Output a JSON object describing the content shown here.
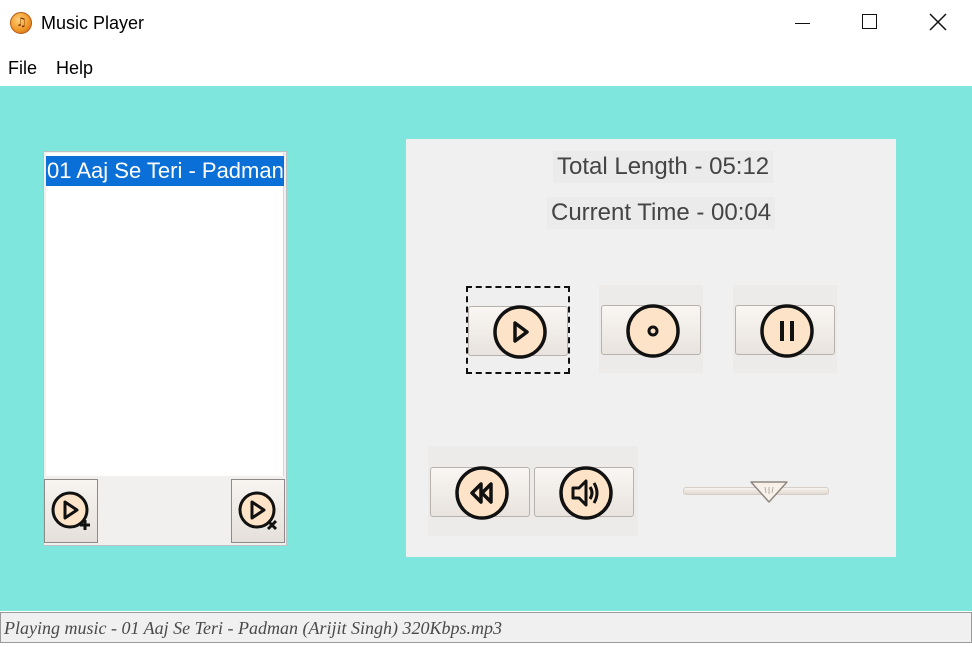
{
  "window": {
    "title": "Music Player",
    "icon": "music-note-app-icon"
  },
  "menu": {
    "items": [
      {
        "label": "File"
      },
      {
        "label": "Help"
      }
    ]
  },
  "playlist": {
    "items": [
      {
        "label": "01 Aaj Se Teri - Padman",
        "selected": true
      }
    ],
    "add_button_icon": "add-to-playlist-icon",
    "delete_button_icon": "remove-from-playlist-icon"
  },
  "player": {
    "total_length": "Total Length - 05:12",
    "current_time": "Current Time - 00:04",
    "controls": {
      "play_icon": "play-icon",
      "stop_icon": "stop-icon",
      "pause_icon": "pause-icon",
      "rewind_icon": "rewind-icon",
      "volume_icon": "speaker-icon"
    },
    "volume": 0.62
  },
  "status": {
    "text": "Playing music - 01 Aaj Se Teri - Padman (Arijit Singh) 320Kbps.mp3"
  },
  "colors": {
    "background": "#7fe6dd",
    "selection": "#0a6fd6",
    "icon_fill": "#fde4c8"
  }
}
